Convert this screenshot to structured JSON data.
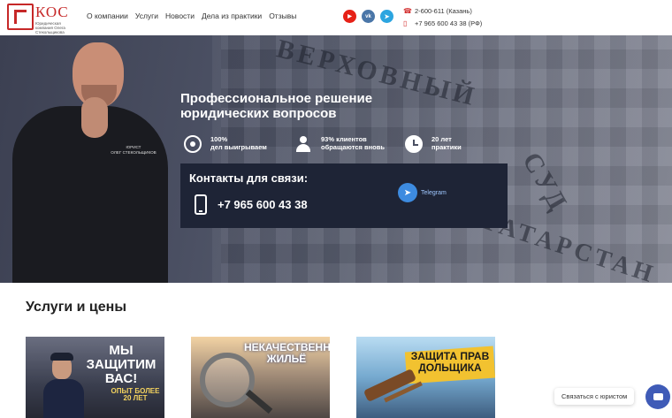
{
  "logo": {
    "text": "КОС",
    "subtitle": "Юридическая компания Олега Стекольщикова"
  },
  "nav": {
    "items": [
      "О компании",
      "Услуги",
      "Новости",
      "Дела из практики",
      "Отзывы"
    ]
  },
  "socials": [
    {
      "name": "youtube-icon",
      "glyph": "▶",
      "color": "#e62117"
    },
    {
      "name": "vk-icon",
      "glyph": "vk",
      "color": "#4a76a8"
    },
    {
      "name": "telegram-icon",
      "glyph": "➤",
      "color": "#2ca5e0"
    }
  ],
  "contacts": {
    "phone1": "2-600-611 (Казань)",
    "phone2": "+7 965 600 43 38 (РФ)"
  },
  "hero": {
    "title": "Профессиональное решение юридических вопросов",
    "badge_role": "ЮРИСТ",
    "badge_name": "ОЛЕГ СТЕКОЛЬЩИКОВ",
    "stats": [
      {
        "line1": "100%",
        "line2": "дел выигрываем",
        "icon": "target-icon"
      },
      {
        "line1": "93% клиентов",
        "line2": "обращаются вновь",
        "icon": "people-icon"
      },
      {
        "line1": "20 лет",
        "line2": "практики",
        "icon": "clock-icon"
      }
    ],
    "contact_title": "Контакты для связи:",
    "contact_phone": "+7 965 600 43 38",
    "telegram_label": "Telegram",
    "building_sign_1": "ВЕРХОВНЫЙ",
    "building_sign_2": "СУД",
    "building_sign_3": "ТАТАРСТАН"
  },
  "services": {
    "title": "Услуги и цены",
    "cards": [
      {
        "caption": "МЫ ЗАЩИТИМ ВАС!",
        "sub": "ОПЫТ БОЛЕЕ 20 ЛЕТ"
      },
      {
        "caption": "НЕКАЧЕСТВЕННОЕ ЖИЛЬЁ",
        "sub": ""
      },
      {
        "caption": "ЗАЩИТА ПРАВ ДОЛЬЩИКА",
        "sub": ""
      }
    ]
  },
  "chat": {
    "label": "Связаться с юристом"
  }
}
